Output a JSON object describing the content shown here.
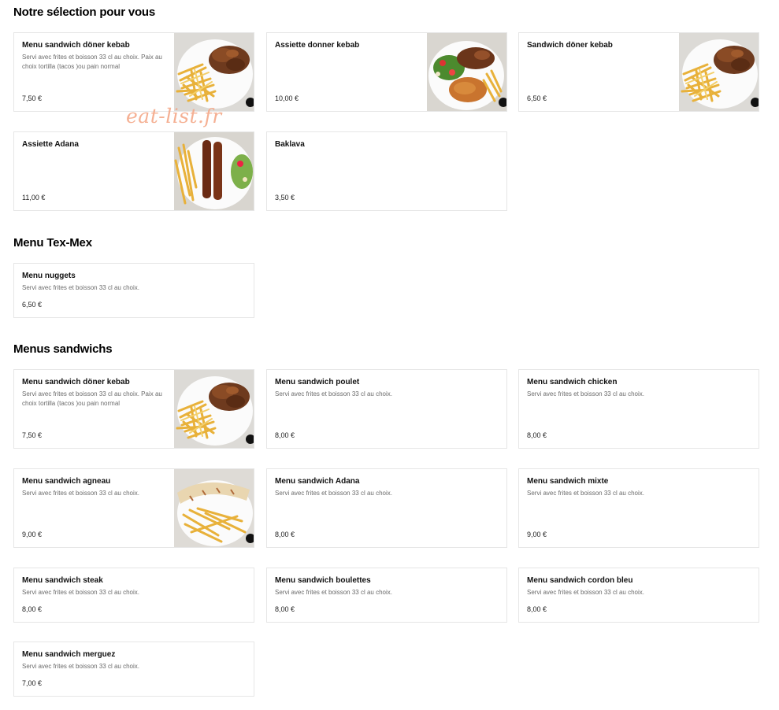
{
  "sections": {
    "selection": {
      "title": "Notre sélection pour vous"
    },
    "texmex": {
      "title": "Menu Tex-Mex"
    },
    "sandwichs": {
      "title": "Menus sandwichs"
    }
  },
  "watermark": "eat-list.fr",
  "items": {
    "sel1": {
      "name": "Menu sandwich döner kebab",
      "desc": "Servi avec frites et boisson 33 cl au choix. Paix au choix tortilla (tacos )ou pain normal",
      "price": "7,50 €",
      "image": "doner-fries-plate"
    },
    "sel2": {
      "name": "Assiette donner kebab",
      "desc": "",
      "price": "10,00 €",
      "image": "doner-rice-salad-plate"
    },
    "sel3": {
      "name": "Sandwich döner kebab",
      "desc": "",
      "price": "6,50 €",
      "image": "doner-fries-plate"
    },
    "sel4": {
      "name": "Assiette Adana",
      "desc": "",
      "price": "11,00 €",
      "image": "adana-skewers-plate"
    },
    "sel5": {
      "name": "Baklava",
      "desc": "",
      "price": "3,50 €"
    },
    "tm1": {
      "name": "Menu nuggets",
      "desc": "Servi avec frites et boisson 33 cl au choix.",
      "price": "6,50 €"
    },
    "ms1": {
      "name": "Menu sandwich döner kebab",
      "desc": "Servi avec frites et boisson 33 cl au choix. Paix au choix tortilla (tacos )ou pain normal",
      "price": "7,50 €",
      "image": "doner-fries-plate"
    },
    "ms2": {
      "name": "Menu sandwich poulet",
      "desc": "Servi avec frites et boisson 33 cl au choix.",
      "price": "8,00 €"
    },
    "ms3": {
      "name": "Menu sandwich chicken",
      "desc": "Servi avec frites et boisson 33 cl au choix.",
      "price": "8,00 €"
    },
    "ms4": {
      "name": "Menu sandwich agneau",
      "desc": "Servi avec frites et boisson 33 cl au choix.",
      "price": "9,00 €",
      "image": "wrap-fries-plate"
    },
    "ms5": {
      "name": "Menu sandwich Adana",
      "desc": "Servi avec frites et boisson 33 cl au choix.",
      "price": "8,00 €"
    },
    "ms6": {
      "name": "Menu sandwich mixte",
      "desc": "Servi avec frites et boisson 33 cl au choix.",
      "price": "9,00 €"
    },
    "ms7": {
      "name": "Menu sandwich steak",
      "desc": "Servi avec frites et boisson 33 cl au choix.",
      "price": "8,00 €"
    },
    "ms8": {
      "name": "Menu sandwich boulettes",
      "desc": "Servi avec frites et boisson 33 cl au choix.",
      "price": "8,00 €"
    },
    "ms9": {
      "name": "Menu sandwich cordon bleu",
      "desc": "Servi avec frites et boisson 33 cl au choix.",
      "price": "8,00 €"
    },
    "ms10": {
      "name": "Menu sandwich merguez",
      "desc": "Servi avec frites et boisson 33 cl au choix.",
      "price": "7,00 €"
    }
  }
}
